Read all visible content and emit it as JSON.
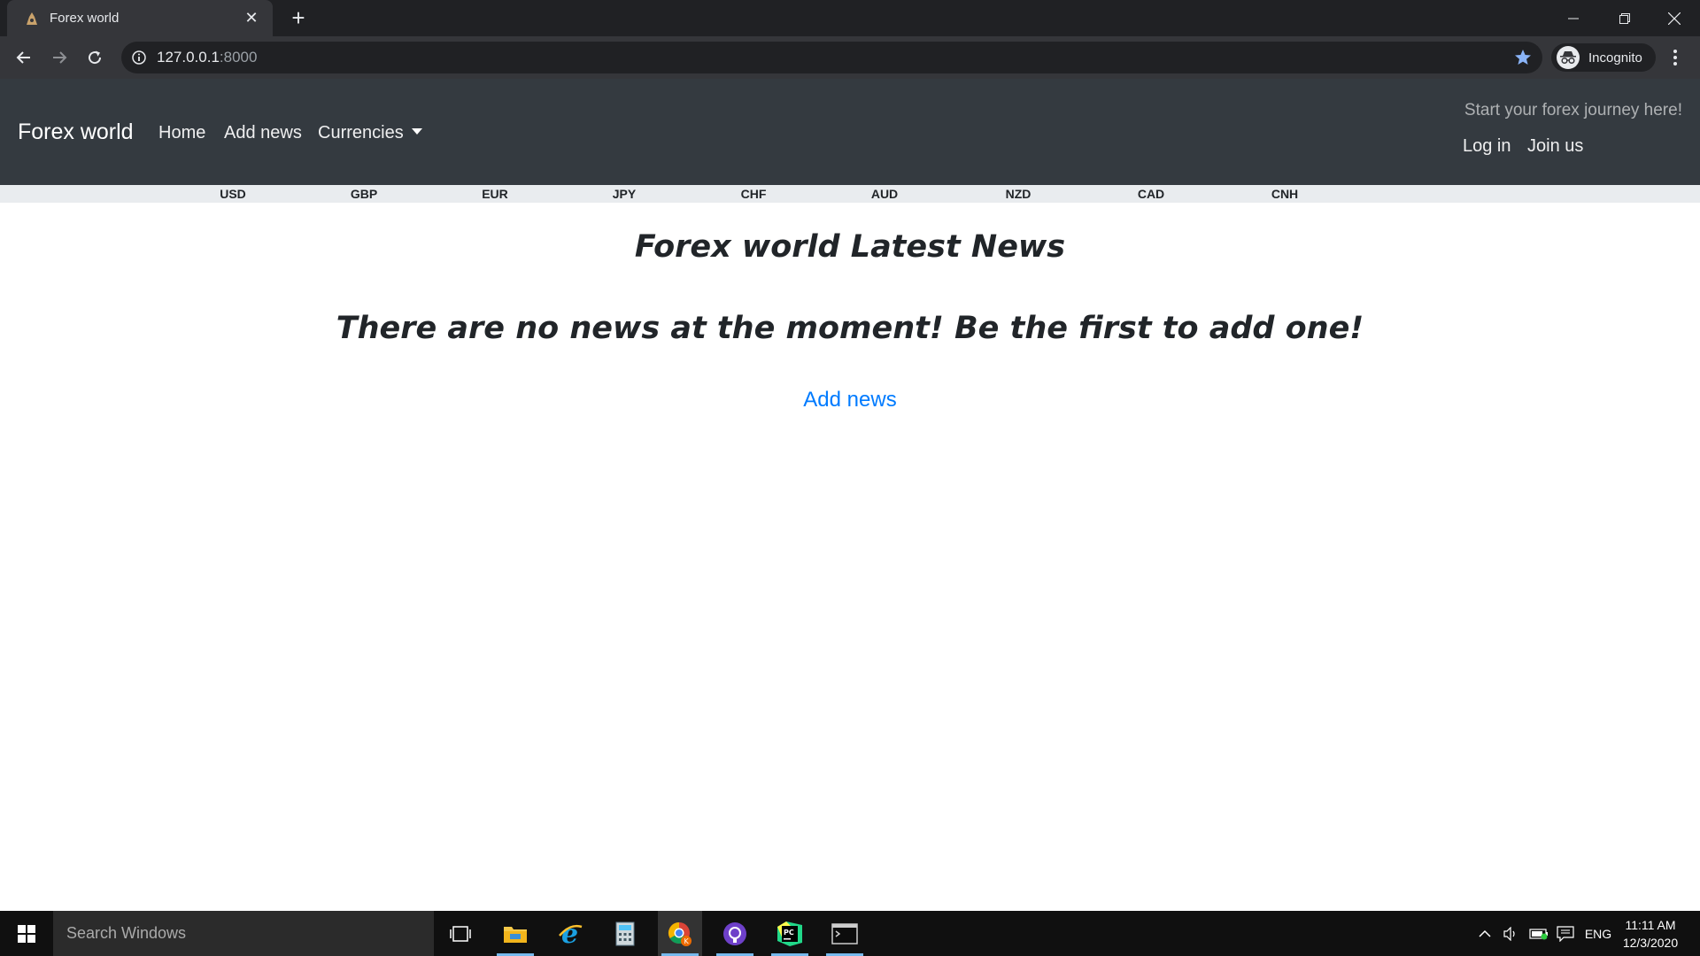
{
  "browser": {
    "tab_title": "Forex world",
    "url_host": "127.0.0.1",
    "url_port": ":8000",
    "profile_label": "Incognito",
    "accent_color": "#8ab4f8"
  },
  "navbar": {
    "brand": "Forex world",
    "links": {
      "home": "Home",
      "add_news": "Add news",
      "currencies": "Currencies"
    },
    "tagline": "Start your forex journey here!",
    "login": "Log in",
    "join": "Join us",
    "bg_color": "#343a40"
  },
  "currencies": [
    "USD",
    "GBP",
    "EUR",
    "JPY",
    "CHF",
    "AUD",
    "NZD",
    "CAD",
    "CNH"
  ],
  "main": {
    "title": "Forex world Latest News",
    "empty_message": "There are no news at the moment! Be the first to add one!",
    "add_link": "Add news",
    "link_color": "#007bff"
  },
  "taskbar": {
    "search_placeholder": "Search Windows",
    "language": "ENG",
    "time": "11:11 AM",
    "date": "12/3/2020",
    "apps": [
      "task-view-icon",
      "file-explorer-icon",
      "internet-explorer-icon",
      "calculator-icon",
      "chrome-icon",
      "github-desktop-icon",
      "pycharm-icon",
      "terminal-icon"
    ]
  }
}
